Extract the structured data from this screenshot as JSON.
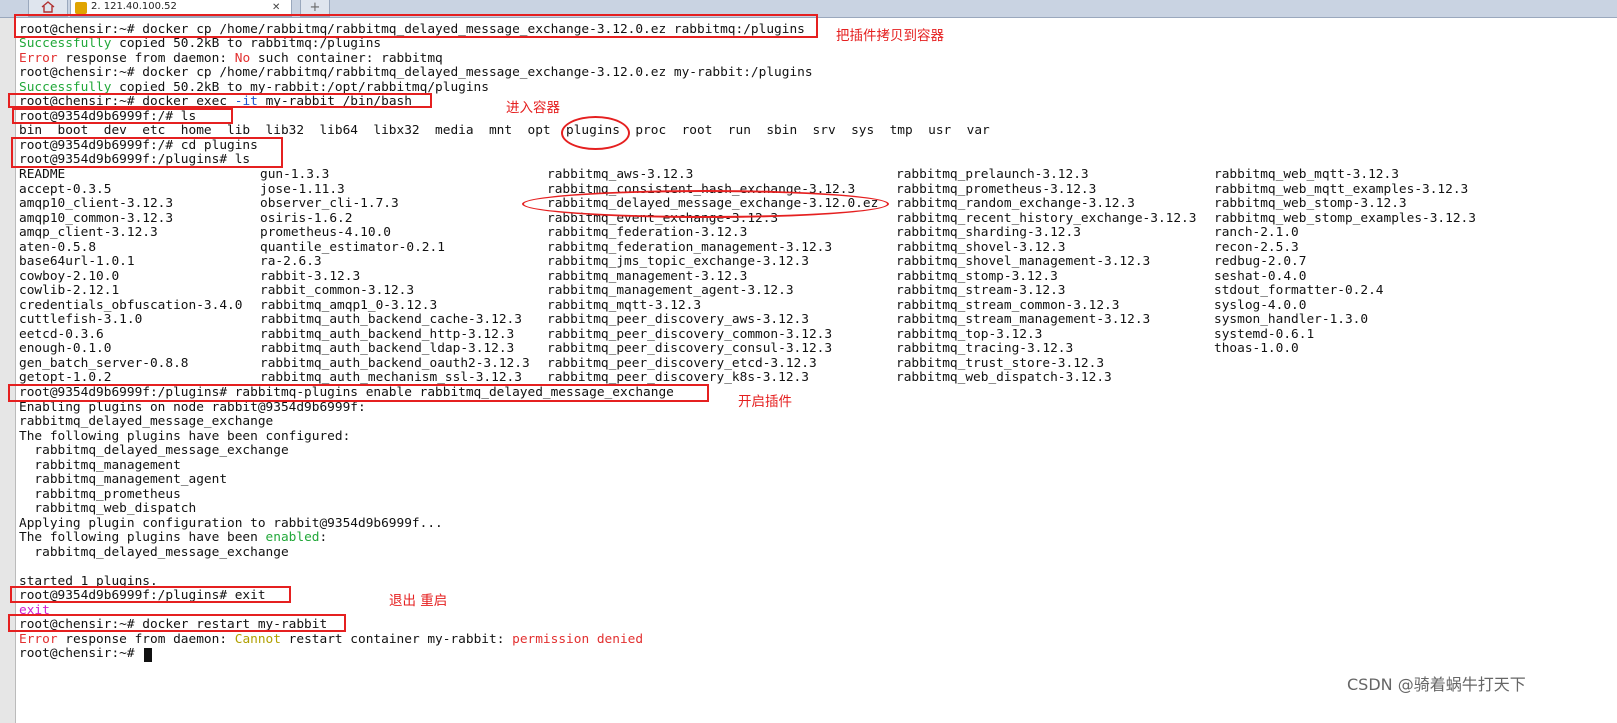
{
  "tab_bar": {
    "home_tab_icon": "home-icon",
    "session_tab_label": "2. 121.40.100.52",
    "session_tab_icon": "wrench-icon",
    "session_tab_close": "✕",
    "new_tab_icon": "plus-icon",
    "new_tab_label": "+"
  },
  "terminal": {
    "line1": "root@chensir:~# docker cp /home/rabbitmq/rabbitmq_delayed_message_exchange-3.12.0.ez rabbitmq:/plugins",
    "line2_a": "Successfully",
    "line2_b": " copied 50.2kB to rabbitmq:/plugins",
    "line3_a": "Error",
    "line3_b": " response from daemon: ",
    "line3_c": "No",
    "line3_d": " such container: rabbitmq",
    "line4": "root@chensir:~# docker cp /home/rabbitmq/rabbitmq_delayed_message_exchange-3.12.0.ez my-rabbit:/plugins",
    "line5_a": "Successfully",
    "line5_b": " copied 50.2kB to my-rabbit:/opt/rabbitmq/plugins",
    "line6_a": "root@chensir:~# docker exec ",
    "line6_b": "-it",
    "line6_c": " my-rabbit /bin/bash",
    "line7": "root@9354d9b6999f:/# ls",
    "line8": "bin  boot  dev  etc  home  lib  lib32  lib64  libx32  media  mnt  opt  plugins  proc  root  run  sbin  srv  sys  tmp  usr  var",
    "line9": "root@9354d9b6999f:/# cd plugins",
    "line10": "root@9354d9b6999f:/plugins# ls",
    "listing_col1": [
      "README",
      "accept-0.3.5",
      "amqp10_client-3.12.3",
      "amqp10_common-3.12.3",
      "amqp_client-3.12.3",
      "aten-0.5.8",
      "base64url-1.0.1",
      "cowboy-2.10.0",
      "cowlib-2.12.1",
      "credentials_obfuscation-3.4.0",
      "cuttlefish-3.1.0",
      "eetcd-0.3.6",
      "enough-0.1.0",
      "gen_batch_server-0.8.8",
      "getopt-1.0.2"
    ],
    "listing_col2": [
      "gun-1.3.3",
      "jose-1.11.3",
      "observer_cli-1.7.3",
      "osiris-1.6.2",
      "prometheus-4.10.0",
      "quantile_estimator-0.2.1",
      "ra-2.6.3",
      "rabbit-3.12.3",
      "rabbit_common-3.12.3",
      "rabbitmq_amqp1_0-3.12.3",
      "rabbitmq_auth_backend_cache-3.12.3",
      "rabbitmq_auth_backend_http-3.12.3",
      "rabbitmq_auth_backend_ldap-3.12.3",
      "rabbitmq_auth_backend_oauth2-3.12.3",
      "rabbitmq_auth_mechanism_ssl-3.12.3"
    ],
    "listing_col3": [
      "rabbitmq_aws-3.12.3",
      "rabbitmq_consistent_hash_exchange-3.12.3",
      "rabbitmq_delayed_message_exchange-3.12.0.ez",
      "rabbitmq_event_exchange-3.12.3",
      "rabbitmq_federation-3.12.3",
      "rabbitmq_federation_management-3.12.3",
      "rabbitmq_jms_topic_exchange-3.12.3",
      "rabbitmq_management-3.12.3",
      "rabbitmq_management_agent-3.12.3",
      "rabbitmq_mqtt-3.12.3",
      "rabbitmq_peer_discovery_aws-3.12.3",
      "rabbitmq_peer_discovery_common-3.12.3",
      "rabbitmq_peer_discovery_consul-3.12.3",
      "rabbitmq_peer_discovery_etcd-3.12.3",
      "rabbitmq_peer_discovery_k8s-3.12.3"
    ],
    "listing_col4": [
      "rabbitmq_prelaunch-3.12.3",
      "rabbitmq_prometheus-3.12.3",
      "rabbitmq_random_exchange-3.12.3",
      "rabbitmq_recent_history_exchange-3.12.3",
      "rabbitmq_sharding-3.12.3",
      "rabbitmq_shovel-3.12.3",
      "rabbitmq_shovel_management-3.12.3",
      "rabbitmq_stomp-3.12.3",
      "rabbitmq_stream-3.12.3",
      "rabbitmq_stream_common-3.12.3",
      "rabbitmq_stream_management-3.12.3",
      "rabbitmq_top-3.12.3",
      "rabbitmq_tracing-3.12.3",
      "rabbitmq_trust_store-3.12.3",
      "rabbitmq_web_dispatch-3.12.3"
    ],
    "listing_col5": [
      "rabbitmq_web_mqtt-3.12.3",
      "rabbitmq_web_mqtt_examples-3.12.3",
      "rabbitmq_web_stomp-3.12.3",
      "rabbitmq_web_stomp_examples-3.12.3",
      "ranch-2.1.0",
      "recon-2.5.3",
      "redbug-2.0.7",
      "seshat-0.4.0",
      "stdout_formatter-0.2.4",
      "syslog-4.0.0",
      "sysmon_handler-1.3.0",
      "systemd-0.6.1",
      "thoas-1.0.0"
    ],
    "line26": "root@9354d9b6999f:/plugins# rabbitmq-plugins enable rabbitmq_delayed_message_exchange",
    "line27": "Enabling plugins on node rabbit@9354d9b6999f:",
    "line28": "rabbitmq_delayed_message_exchange",
    "line29": "The following plugins have been configured:",
    "line30": "  rabbitmq_delayed_message_exchange",
    "line31": "  rabbitmq_management",
    "line32": "  rabbitmq_management_agent",
    "line33": "  rabbitmq_prometheus",
    "line34": "  rabbitmq_web_dispatch",
    "line35": "Applying plugin configuration to rabbit@9354d9b6999f...",
    "line36_a": "The following plugins have been ",
    "line36_b": "enabled",
    "line36_c": ":",
    "line37": "  rabbitmq_delayed_message_exchange",
    "line39": "started 1 plugins.",
    "line40": "root@9354d9b6999f:/plugins# exit",
    "line41": "exit",
    "line42": "root@chensir:~# docker restart my-rabbit",
    "line43_a": "Error",
    "line43_b": " response from daemon: ",
    "line43_c": "Cannot",
    "line43_d": " restart container my-rabbit: ",
    "line43_e": "permission denied",
    "line44": "root@chensir:~# "
  },
  "annotations": {
    "copy_plugin": "把插件拷贝到容器",
    "enter_container": "进入容器",
    "enable_plugin": "开启插件",
    "exit_restart": "退出 重启"
  },
  "watermark": "CSDN @骑着蜗牛打天下",
  "colors": {
    "success": "#22a83a",
    "error": "#e23030",
    "option": "#2255cc",
    "annotation": "#e52020"
  }
}
